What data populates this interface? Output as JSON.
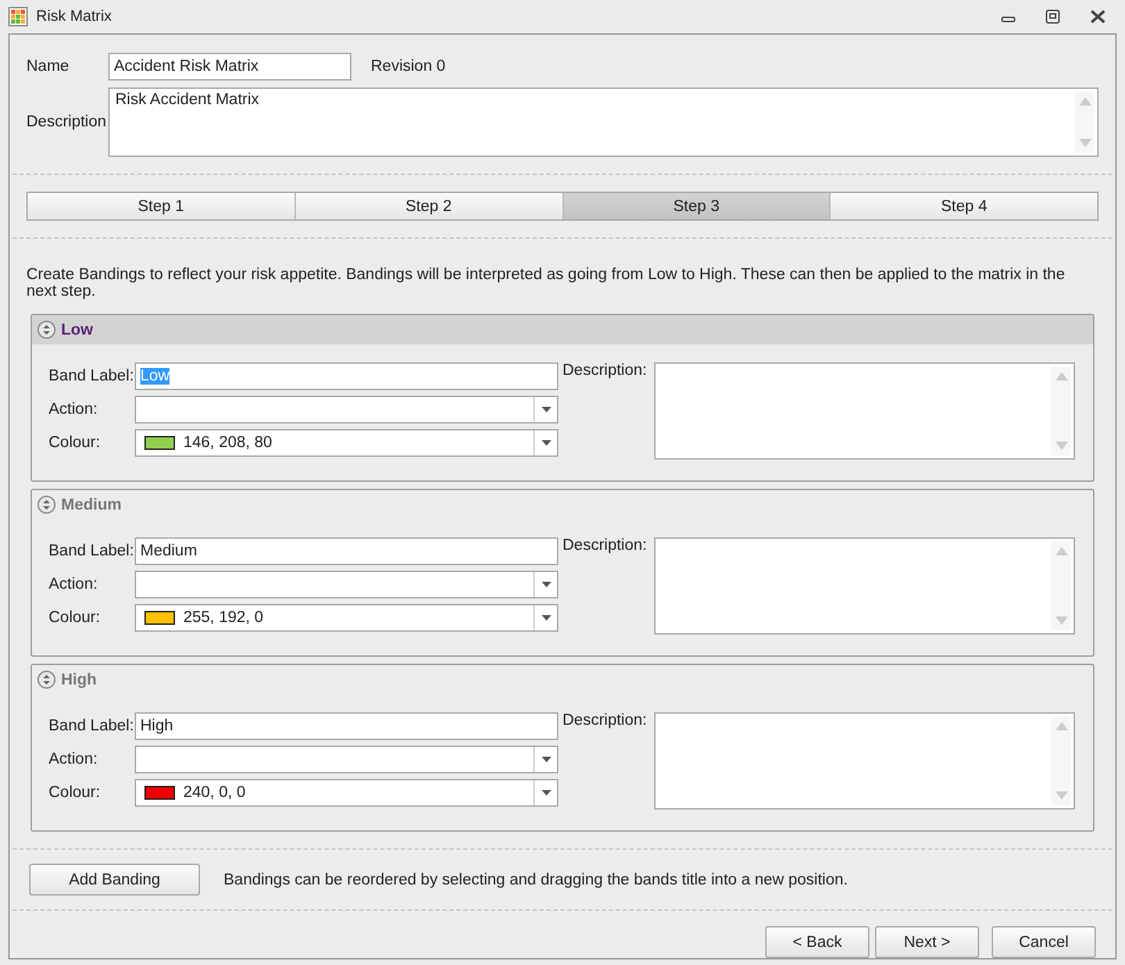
{
  "window": {
    "title": "Risk Matrix"
  },
  "name": {
    "label": "Name",
    "value": "Accident Risk Matrix"
  },
  "revision": "Revision 0",
  "description": {
    "label": "Description",
    "value": "Risk Accident Matrix"
  },
  "steps": [
    {
      "label": "Step 1",
      "selected": false
    },
    {
      "label": "Step 2",
      "selected": false
    },
    {
      "label": "Step 3",
      "selected": true
    },
    {
      "label": "Step 4",
      "selected": false
    }
  ],
  "instructions": "Create Bandings to reflect your risk appetite. Bandings will be interpreted as going from Low to High. These can then be applied to the matrix in the next step.",
  "bands": [
    {
      "title": "Low",
      "selected": true,
      "band_label_label": "Band Label:",
      "band_label": "Low",
      "action_label": "Action:",
      "colour_label": "Colour:",
      "colour": "146, 208, 80",
      "color": "#92d050",
      "description_label": "Description:"
    },
    {
      "title": "Medium",
      "selected": false,
      "band_label_label": "Band Label:",
      "band_label": "Medium",
      "action_label": "Action:",
      "colour_label": "Colour:",
      "colour": "255, 192, 0",
      "color": "#ffc000",
      "description_label": "Description:"
    },
    {
      "title": "High",
      "selected": false,
      "band_label_label": "Band Label:",
      "band_label": "High",
      "action_label": "Action:",
      "colour_label": "Colour:",
      "colour": "240, 0, 0",
      "color": "#f00000",
      "description_label": "Description:"
    }
  ],
  "add_button": "Add Banding",
  "hint": "Bandings can be reordered by selecting and dragging the bands title into a new position.",
  "buttons": [
    "< Back",
    "Next >",
    "Cancel"
  ]
}
